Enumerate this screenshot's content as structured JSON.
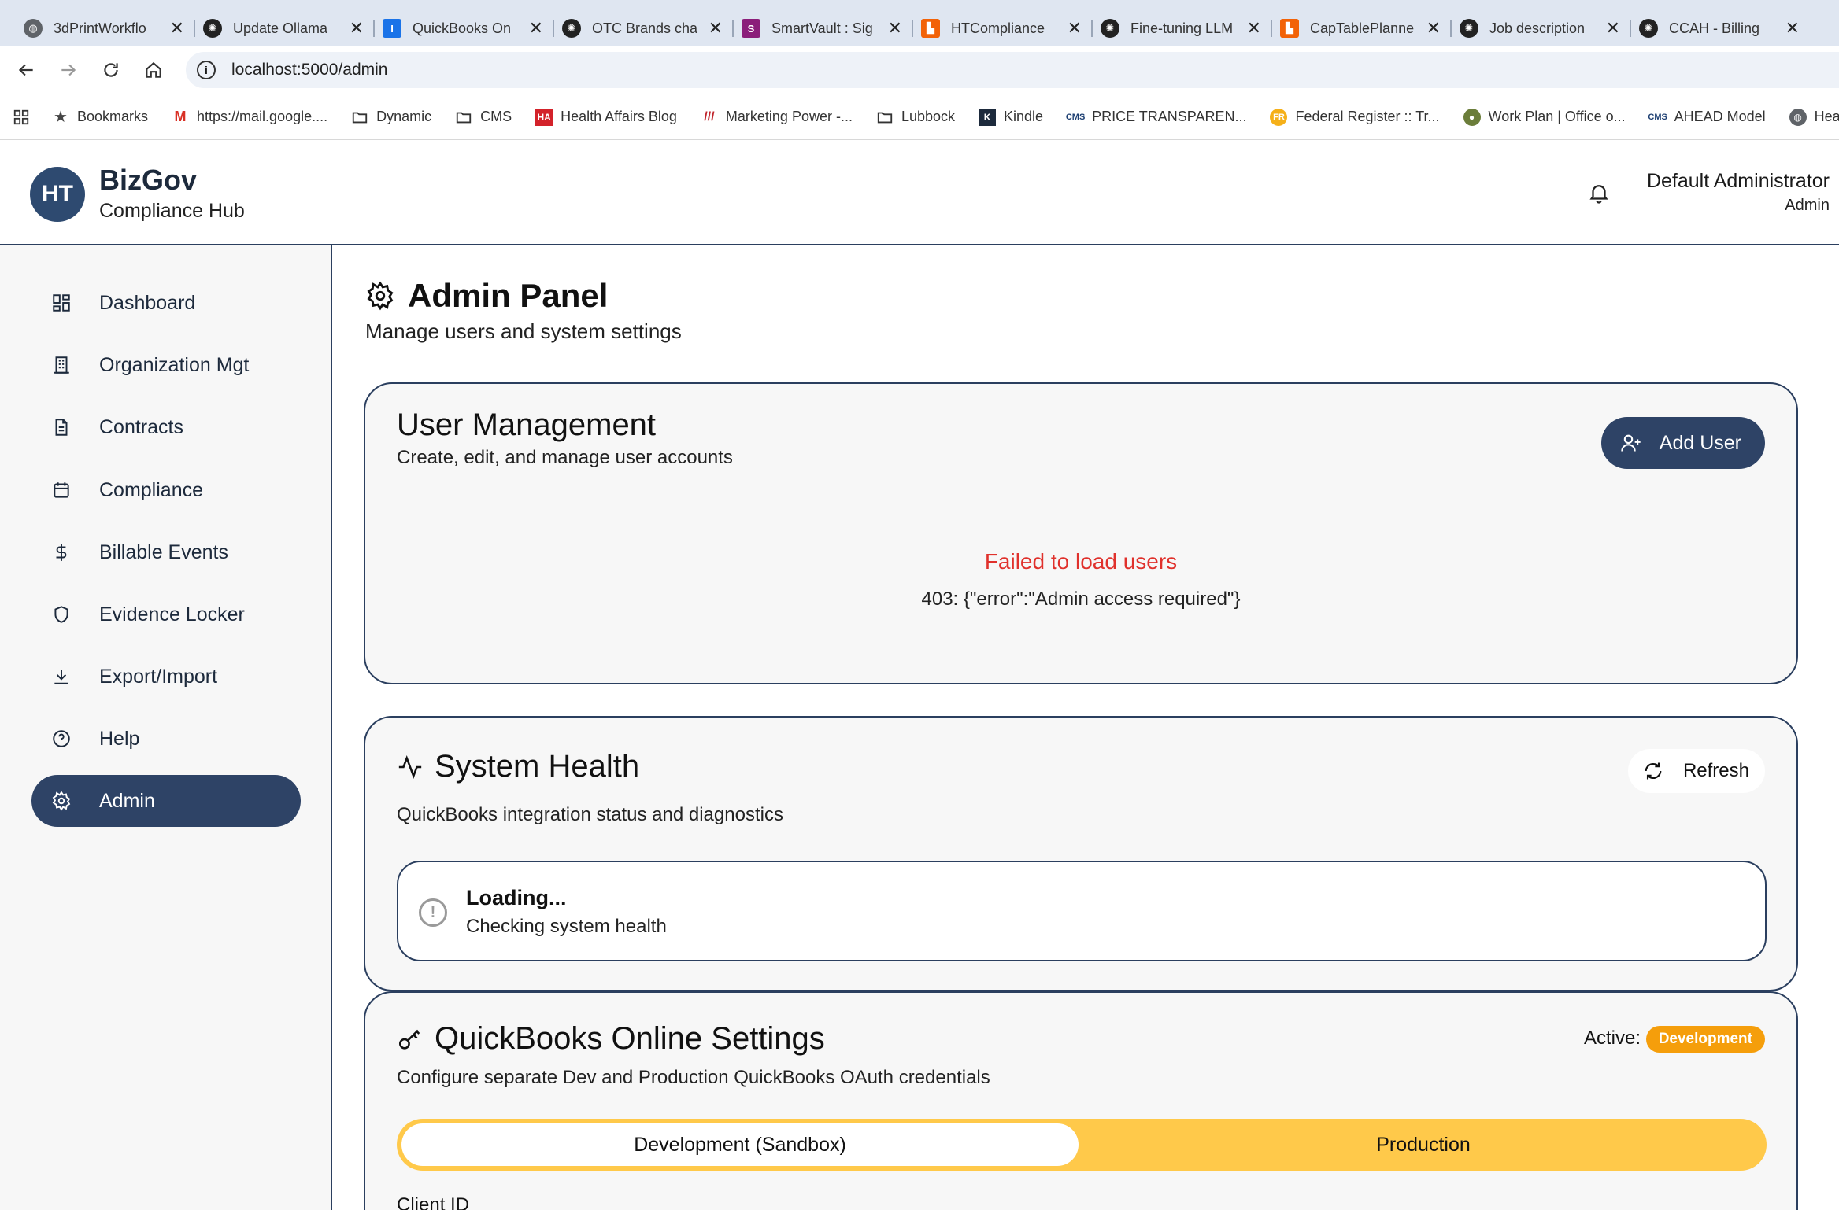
{
  "browser": {
    "tabs": [
      {
        "title": "3dPrintWorkflo",
        "icon": "globe-icon",
        "color": "#5f6368"
      },
      {
        "title": "Update Ollama",
        "icon": "openai-icon",
        "color": "#222222"
      },
      {
        "title": "QuickBooks On",
        "icon": "quickbooks-icon",
        "color": "#1a73e8"
      },
      {
        "title": "OTC Brands cha",
        "icon": "openai-icon",
        "color": "#222222"
      },
      {
        "title": "SmartVault : Sig",
        "icon": "smartvault-icon",
        "color": "#8b1e7a"
      },
      {
        "title": "HTCompliance",
        "icon": "replit-icon",
        "color": "#f26207"
      },
      {
        "title": "Fine-tuning LLM",
        "icon": "openai-icon",
        "color": "#222222"
      },
      {
        "title": "CapTablePlanne",
        "icon": "replit-icon",
        "color": "#f26207"
      },
      {
        "title": "Job description",
        "icon": "openai-icon",
        "color": "#222222"
      },
      {
        "title": "CCAH - Billing",
        "icon": "openai-icon",
        "color": "#222222"
      }
    ],
    "url": "localhost:5000/admin",
    "bookmarks": [
      {
        "label": "Bookmarks",
        "icon": "star-icon"
      },
      {
        "label": "https://mail.google....",
        "icon": "gmail-icon"
      },
      {
        "label": "Dynamic",
        "icon": "folder-icon"
      },
      {
        "label": "CMS",
        "icon": "folder-icon"
      },
      {
        "label": "Health Affairs Blog",
        "icon": "ha-icon"
      },
      {
        "label": "Marketing Power -...",
        "icon": "mp-icon"
      },
      {
        "label": "Lubbock",
        "icon": "folder-icon"
      },
      {
        "label": "Kindle",
        "icon": "kindle-icon"
      },
      {
        "label": "PRICE TRANSPAREN...",
        "icon": "cms-icon"
      },
      {
        "label": "Federal Register :: Tr...",
        "icon": "fr-icon"
      },
      {
        "label": "Work Plan | Office o...",
        "icon": "seal-icon"
      },
      {
        "label": "AHEAD Model",
        "icon": "cms-icon"
      },
      {
        "label": "Health Tr",
        "icon": "globe-icon"
      }
    ]
  },
  "header": {
    "logo_initials": "HT",
    "title": "BizGov",
    "subtitle": "Compliance Hub",
    "user_name": "Default Administrator",
    "user_role": "Admin"
  },
  "sidebar": {
    "items": [
      {
        "label": "Dashboard",
        "icon": "dashboard-icon"
      },
      {
        "label": "Organization Mgt",
        "icon": "building-icon"
      },
      {
        "label": "Contracts",
        "icon": "document-icon"
      },
      {
        "label": "Compliance",
        "icon": "calendar-icon"
      },
      {
        "label": "Billable Events",
        "icon": "dollar-icon"
      },
      {
        "label": "Evidence Locker",
        "icon": "shield-icon"
      },
      {
        "label": "Export/Import",
        "icon": "download-icon"
      },
      {
        "label": "Help",
        "icon": "help-icon"
      },
      {
        "label": "Admin",
        "icon": "gear-icon",
        "active": true
      }
    ]
  },
  "page": {
    "title": "Admin Panel",
    "subtitle": "Manage users and system settings"
  },
  "user_management": {
    "title": "User Management",
    "subtitle": "Create, edit, and manage user accounts",
    "add_button": "Add User",
    "error_title": "Failed to load users",
    "error_message": "403: {\"error\":\"Admin access required\"}"
  },
  "system_health": {
    "title": "System Health",
    "subtitle": "QuickBooks integration status and diagnostics",
    "refresh_button": "Refresh",
    "status_title": "Loading...",
    "status_message": "Checking system health"
  },
  "quickbooks": {
    "title": "QuickBooks Online Settings",
    "subtitle": "Configure separate Dev and Production QuickBooks OAuth credentials",
    "active_label": "Active:",
    "active_badge": "Development",
    "tabs": [
      "Development (Sandbox)",
      "Production"
    ],
    "field_label": "Client ID"
  },
  "colors": {
    "primary": "#2e4366",
    "error": "#e0312c",
    "badge": "#f59e0b",
    "segment": "#ffc94a"
  }
}
